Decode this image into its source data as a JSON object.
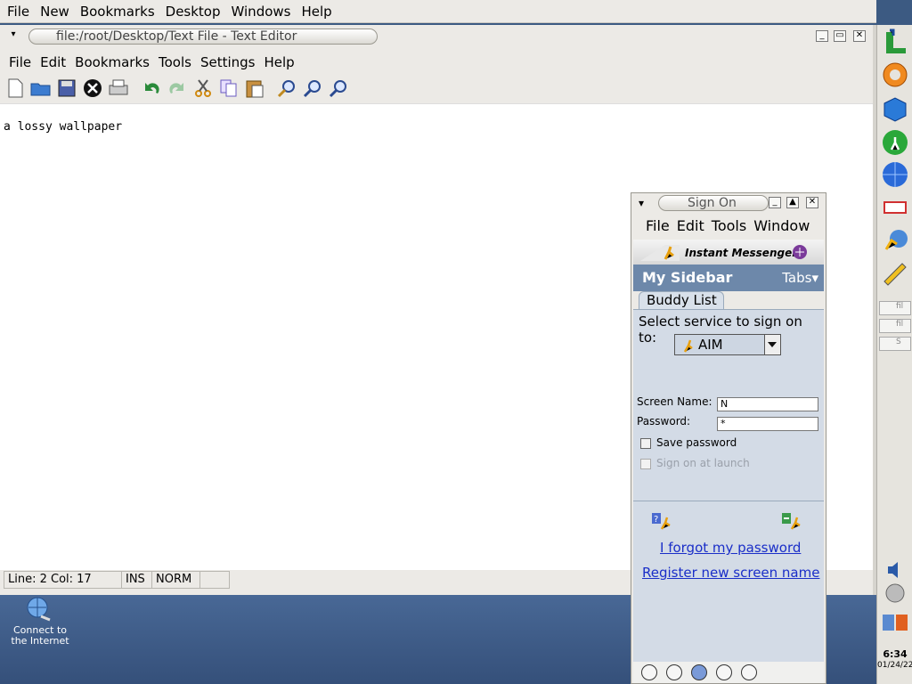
{
  "topbar": {
    "items": [
      "File",
      "New",
      "Bookmarks",
      "Desktop",
      "Windows",
      "Help"
    ]
  },
  "editor": {
    "title": "file:/root/Desktop/Text File - Text Editor",
    "menu": [
      "File",
      "Edit",
      "Bookmarks",
      "Tools",
      "Settings",
      "Help"
    ],
    "toolbar_icons": [
      "new-file-icon",
      "open-folder-icon",
      "save-icon",
      "close-doc-icon",
      "print-icon",
      "undo-icon",
      "redo-icon",
      "cut-icon",
      "copy-icon",
      "paste-icon",
      "find-icon",
      "zoom-in-icon",
      "zoom-out-icon"
    ],
    "content": "a lossy wallpaper",
    "status": {
      "position": "Line: 2 Col: 17",
      "mode_ins": "INS",
      "mode_norm": "NORM"
    }
  },
  "desktop": {
    "icon_label": "Connect to the Internet"
  },
  "aim": {
    "title": "Sign On",
    "menu": [
      "File",
      "Edit",
      "Tools",
      "Window"
    ],
    "brand": "Instant Messenger",
    "sidebar_title": "My Sidebar",
    "tabs_label": "Tabs",
    "buddy_tab": "Buddy List",
    "service_label": "Select service to sign on to:",
    "service_value": "AIM",
    "screen_name_label": "Screen Name:",
    "screen_name_value": "N",
    "password_label": "Password:",
    "password_value": "*",
    "save_password": "Save password",
    "sign_on_launch": "Sign on at launch",
    "forgot_link": "I forgot my password",
    "register_link": "Register new screen name"
  },
  "clock": {
    "time": "6:34",
    "date": "01/24/22"
  },
  "colors": {
    "sidebar_header": "#6d88aa",
    "link": "#1a2ec8",
    "desktop": "#3c5a82"
  }
}
